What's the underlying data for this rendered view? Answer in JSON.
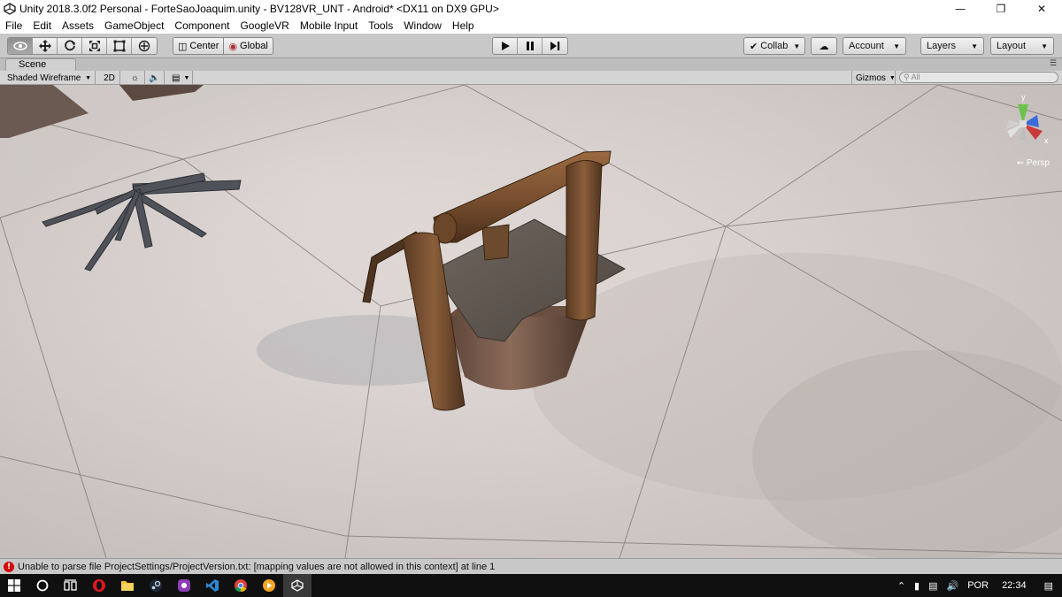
{
  "window": {
    "title": "Unity 2018.3.0f2 Personal - ForteSaoJoaquim.unity - BV128VR_UNT - Android* <DX11 on DX9 GPU>",
    "controls": [
      "minimize-icon",
      "restore-icon",
      "close-icon"
    ]
  },
  "menu": [
    "File",
    "Edit",
    "Assets",
    "GameObject",
    "Component",
    "GoogleVR",
    "Mobile Input",
    "Tools",
    "Window",
    "Help"
  ],
  "toolbar": {
    "transform_tools": [
      "view-tool-icon",
      "move-tool-icon",
      "rotate-tool-icon",
      "scale-tool-icon",
      "rect-tool-icon",
      "transform-tool-icon"
    ],
    "pivot_label": "Center",
    "space_label": "Global",
    "play_controls": [
      "play-icon",
      "pause-icon",
      "step-icon"
    ],
    "collab_label": "Collab",
    "account_label": "Account",
    "layers_label": "Layers",
    "layout_label": "Layout"
  },
  "scene": {
    "tab_label": "Scene",
    "shading_mode": "Shaded Wireframe",
    "mode_2d": "2D",
    "gizmos_label": "Gizmos",
    "search_placeholder": "All",
    "projection_label": "Persp",
    "axis_y": "y",
    "axis_x": "x"
  },
  "status": {
    "message": "Unable to parse file ProjectSettings/ProjectVersion.txt: [mapping values are not allowed in this context] at line 1",
    "level": "error"
  },
  "taskbar": {
    "apps": [
      "windows-start-icon",
      "cortana-icon",
      "task-view-icon",
      "opera-icon",
      "file-explorer-icon",
      "steam-icon",
      "app-purple-icon",
      "vscode-icon",
      "chrome-icon",
      "media-player-icon",
      "unity-icon"
    ],
    "language": "POR",
    "time": "22:34"
  },
  "colors": {
    "error": "#d10b0b",
    "toolbar_bg": "#c8c8c8",
    "taskbar_bg": "#101010"
  }
}
